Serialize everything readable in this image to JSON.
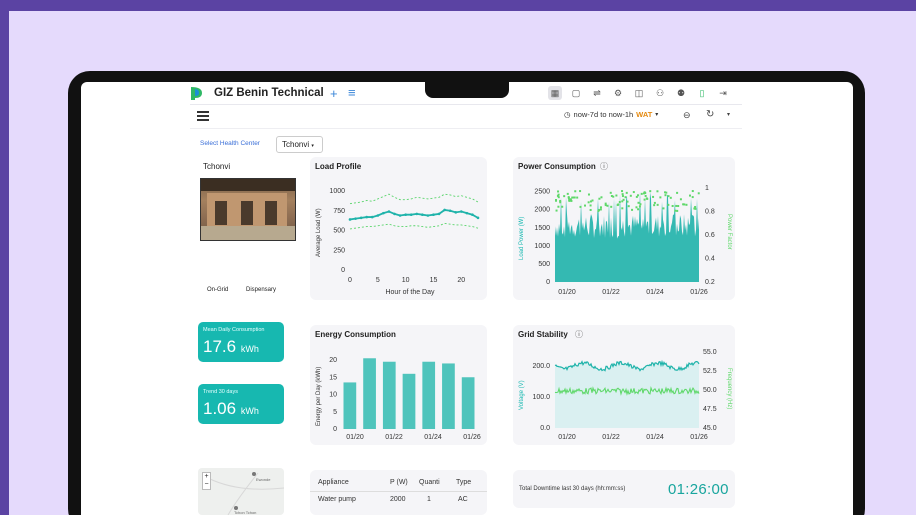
{
  "app": {
    "title": "GIZ Benin Technical"
  },
  "toolbar": {
    "icons": [
      "dashboard-icon",
      "folder-icon",
      "cart-icon",
      "settings-icon",
      "book-icon",
      "user-icon",
      "users-icon",
      "battery-icon",
      "logout-icon"
    ],
    "time_range": "now-7d to now-1h",
    "timezone": "WAT"
  },
  "filters": {
    "health_center_label": "Select Health Center",
    "health_center_value": "Tchonvi"
  },
  "facility": {
    "name": "Tchonvi",
    "grid_tag": "On-Grid",
    "type_tag": "Dispensary"
  },
  "stats": {
    "mean_daily": {
      "label": "Mean Daily Consumption",
      "value": "17.6",
      "unit": "kWh"
    },
    "trend": {
      "label": "Trend 30 days",
      "value": "1.06",
      "unit": "kWh"
    }
  },
  "load_profile": {
    "title": "Load Profile",
    "ylabel": "Average Load (W)",
    "xlabel": "Hour of the Day",
    "yticks": [
      "1000",
      "750",
      "500",
      "250",
      "0"
    ],
    "xticks": [
      "0",
      "5",
      "10",
      "15",
      "20"
    ]
  },
  "power_consumption": {
    "title": "Power Consumption",
    "ylabel_left": "Load Power (W)",
    "ylabel_right": "Power Factor",
    "yticks_left": [
      "2500",
      "2000",
      "1500",
      "1000",
      "500",
      "0"
    ],
    "yticks_right": [
      "1",
      "0.8",
      "0.6",
      "0.4",
      "0.2"
    ],
    "xticks": [
      "01/20",
      "01/22",
      "01/24",
      "01/26"
    ]
  },
  "energy_consumption": {
    "title": "Energy Consumption",
    "ylabel": "Energy per Day (kWh)",
    "yticks": [
      "20",
      "15",
      "10",
      "5",
      "0"
    ],
    "xticks": [
      "01/20",
      "01/22",
      "01/24",
      "01/26"
    ]
  },
  "grid_stability": {
    "title": "Grid Stability",
    "ylabel_left": "Voltage (V)",
    "ylabel_right": "Frequency (Hz)",
    "yticks_left": [
      "200.0",
      "100.0",
      "0.0"
    ],
    "yticks_right": [
      "55.0",
      "52.5",
      "50.0",
      "47.5",
      "45.0"
    ],
    "xticks": [
      "01/20",
      "01/22",
      "01/24",
      "01/26"
    ]
  },
  "map": {
    "zoom_in": "+",
    "zoom_out": "−",
    "place_1": "Ewonde",
    "place_2": "Tchon Tchon"
  },
  "appliances": {
    "headers": [
      "Appliance",
      "P (W)",
      "Quanti",
      "Type"
    ],
    "rows": [
      [
        "Water pump",
        "2000",
        "1",
        "AC"
      ]
    ]
  },
  "downtime": {
    "label": "Total Downtime last 30 days (hh:mm:ss)",
    "value": "01:26:00"
  },
  "chart_data": [
    {
      "type": "line",
      "title": "Load Profile",
      "xlabel": "Hour of the Day",
      "ylabel": "Average Load (W)",
      "ylim": [
        0,
        1000
      ],
      "x": [
        0,
        1,
        2,
        3,
        4,
        5,
        6,
        7,
        8,
        9,
        10,
        11,
        12,
        13,
        14,
        15,
        16,
        17,
        18,
        19,
        20,
        21,
        22,
        23
      ],
      "series": [
        {
          "name": "mean",
          "values": [
            640,
            650,
            660,
            670,
            670,
            690,
            720,
            740,
            710,
            690,
            700,
            700,
            710,
            700,
            690,
            700,
            710,
            760,
            750,
            730,
            740,
            720,
            700,
            660
          ]
        },
        {
          "name": "upper",
          "values": [
            840,
            850,
            860,
            880,
            870,
            900,
            930,
            960,
            920,
            890,
            890,
            900,
            920,
            910,
            900,
            910,
            920,
            960,
            950,
            930,
            940,
            920,
            900,
            860
          ]
        },
        {
          "name": "lower",
          "values": [
            520,
            530,
            540,
            550,
            550,
            560,
            570,
            580,
            560,
            550,
            550,
            560,
            560,
            550,
            540,
            550,
            560,
            590,
            580,
            570,
            570,
            560,
            550,
            530
          ]
        }
      ]
    },
    {
      "type": "bar",
      "title": "Energy Consumption",
      "ylabel": "Energy per Day (kWh)",
      "categories": [
        "01/20",
        "01/21",
        "01/22",
        "01/23",
        "01/24",
        "01/25",
        "01/26"
      ],
      "values": [
        13.5,
        20.5,
        19.5,
        16,
        19.5,
        19,
        15
      ],
      "ylim": [
        0,
        22
      ]
    },
    {
      "type": "area",
      "title": "Power Consumption",
      "ylabel": "Load Power (W)",
      "y2label": "Power Factor",
      "ylim": [
        0,
        2600
      ],
      "y2lim": [
        0.2,
        1.0
      ],
      "xticks": [
        "01/20",
        "01/22",
        "01/24",
        "01/26"
      ]
    },
    {
      "type": "line",
      "title": "Grid Stability",
      "ylabel": "Voltage (V)",
      "y2label": "Frequency (Hz)",
      "ylim": [
        0,
        250
      ],
      "y2lim": [
        45,
        55
      ],
      "xticks": [
        "01/20",
        "01/22",
        "01/24",
        "01/26"
      ]
    }
  ],
  "colors": {
    "teal": "#17b8b0",
    "green": "#5fd86a",
    "brand_purple": "#5b43a3",
    "backdrop": "#e5dafc"
  }
}
